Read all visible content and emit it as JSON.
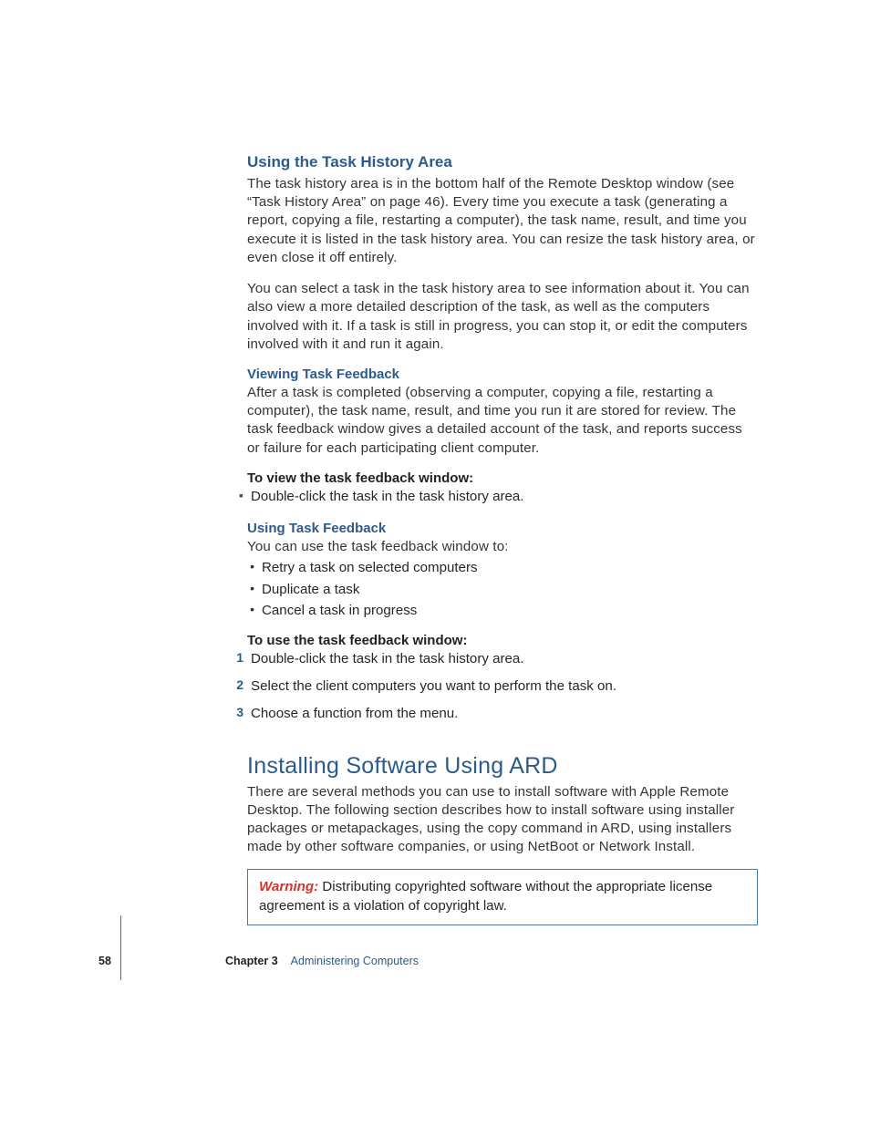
{
  "s1": {
    "title": "Using the Task History Area",
    "p1": "The task history area is in the bottom half of the Remote Desktop window (see “Task History Area” on page 46). Every time you execute a task (generating a report, copying a file, restarting a computer), the task name, result, and time you execute it is listed in the task history area. You can resize the task history area, or even close it off entirely.",
    "p2": "You can select a task in the task history area to see information about it. You can also view a more detailed description of the task, as well as the computers involved with it. If a task is still in progress, you can stop it, or edit the computers involved with it and run it again."
  },
  "s2": {
    "title": "Viewing Task Feedback",
    "p1": "After a task is completed (observing a computer, copying a file, restarting a computer), the task name, result, and time you run it are stored for review. The task feedback window gives a detailed account of the task, and reports success or failure for each participating client computer.",
    "stepTitle": "To view the task feedback window:",
    "bullet": "Double-click the task in the task history area."
  },
  "s3": {
    "title": "Using Task Feedback",
    "intro": "You can use the task feedback window to:",
    "b1": "Retry a task on selected computers",
    "b2": "Duplicate a task",
    "b3": "Cancel a task in progress",
    "stepTitle": "To use the task feedback window:",
    "o1": "Double-click the task in the task history area.",
    "o2": "Select the client computers you want to perform the task on.",
    "o3": "Choose a function from the menu."
  },
  "s4": {
    "title": "Installing Software Using ARD",
    "p1": "There are several methods you can use to install software with Apple Remote Desktop. The following section describes how to install software using installer packages or metapackages, using the copy command in ARD, using installers made by other software companies, or using NetBoot or Network Install."
  },
  "warning": {
    "lead": "Warning:",
    "text": "  Distributing copyrighted software without the appropriate license agreement is a violation of copyright law."
  },
  "footer": {
    "page": "58",
    "chapter": "Chapter 3",
    "title": "Administering Computers"
  }
}
